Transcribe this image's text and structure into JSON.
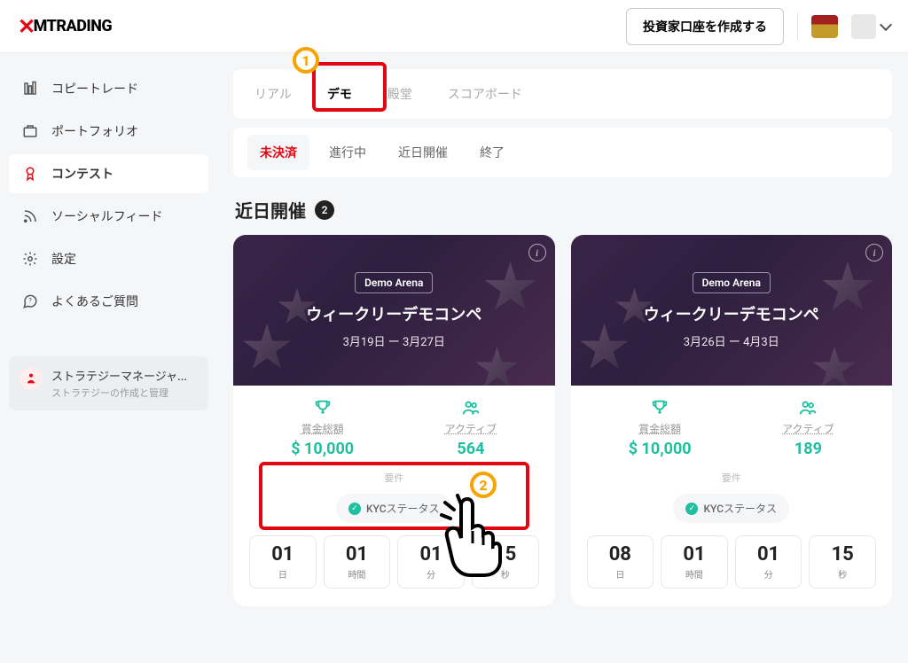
{
  "header": {
    "logo_text": "MTRADING",
    "create_account_label": "投資家口座を作成する"
  },
  "sidebar": {
    "items": [
      {
        "label": "コピートレード"
      },
      {
        "label": "ポートフォリオ"
      },
      {
        "label": "コンテスト"
      },
      {
        "label": "ソーシャルフィード"
      },
      {
        "label": "設定"
      },
      {
        "label": "よくあるご質問"
      }
    ],
    "strategy": {
      "title": "ストラテジーマネージャ...",
      "subtitle": "ストラテジーの作成と管理"
    }
  },
  "tabs": [
    {
      "label": "リアル"
    },
    {
      "label": "デモ"
    },
    {
      "label": "殿堂"
    },
    {
      "label": "スコアボード"
    }
  ],
  "filter_tabs": [
    {
      "label": "未決済"
    },
    {
      "label": "進行中"
    },
    {
      "label": "近日開催"
    },
    {
      "label": "終了"
    }
  ],
  "section_title": "近日開催",
  "section_count": "2",
  "cards": [
    {
      "arena": "Demo Arena",
      "title": "ウィークリーデモコンペ",
      "dates": "3月19日 ー 3月27日",
      "prize_label": "賞金総額",
      "prize_value": "$ 10,000",
      "active_label": "アクティブ",
      "active_value": "564",
      "req_label": "要件",
      "kyc_label": "KYCステータス",
      "countdown": [
        {
          "num": "01",
          "unit": "日"
        },
        {
          "num": "01",
          "unit": "時間"
        },
        {
          "num": "01",
          "unit": "分"
        },
        {
          "num": "15",
          "unit": "秒"
        }
      ]
    },
    {
      "arena": "Demo Arena",
      "title": "ウィークリーデモコンペ",
      "dates": "3月26日 ー 4月3日",
      "prize_label": "賞金総額",
      "prize_value": "$ 10,000",
      "active_label": "アクティブ",
      "active_value": "189",
      "req_label": "要件",
      "kyc_label": "KYCステータス",
      "countdown": [
        {
          "num": "08",
          "unit": "日"
        },
        {
          "num": "01",
          "unit": "時間"
        },
        {
          "num": "01",
          "unit": "分"
        },
        {
          "num": "15",
          "unit": "秒"
        }
      ]
    }
  ],
  "annotations": {
    "one": "1",
    "two": "2"
  }
}
